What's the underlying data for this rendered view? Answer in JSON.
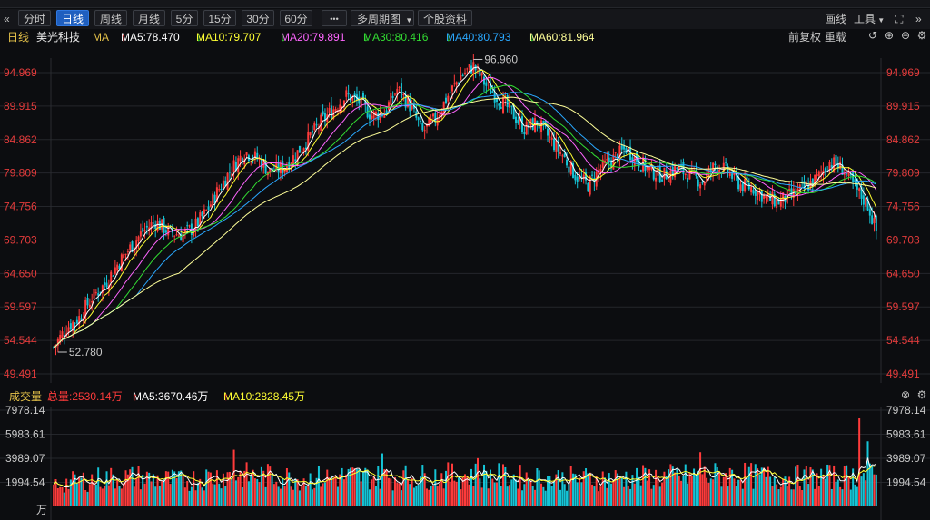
{
  "toolbar": {
    "back_glyph": "«",
    "periods": [
      "分时",
      "日线",
      "周线",
      "月线",
      "5分",
      "15分",
      "30分",
      "60分"
    ],
    "active_period": "日线",
    "more_label": "•••",
    "multi_period_label": "多周期图",
    "profile_label": "个股资料",
    "draw_label": "画线",
    "tools_label": "工具",
    "fullscreen_glyph": "⛶",
    "expand_glyph": "»"
  },
  "ma_bar": {
    "period": "日线",
    "stock": "美光科技",
    "ma": "MA",
    "ma5": "MA5:78.470",
    "ma10": "MA10:79.707",
    "ma20": "MA20:79.891",
    "ma30": "MA30:80.416",
    "ma40": "MA40:80.793",
    "ma60": "MA60:81.964",
    "adjust_label": "前复权",
    "reload_label": "重载"
  },
  "vol_bar": {
    "title": "成交量",
    "total": "总量:2530.14万",
    "ma5": "MA5:3670.46万",
    "ma10": "MA10:2828.45万"
  },
  "colors": {
    "up": "#ff3b3b",
    "down": "#15c4d6",
    "ma5": "#ffffff",
    "ma10": "#ffff33",
    "ma20": "#ff66ff",
    "ma30": "#33dd33",
    "ma40": "#2aa8ff",
    "ma60": "#ffff99"
  },
  "chart_data": {
    "type": "candlestick",
    "price_ticks": [
      "94.969",
      "89.915",
      "84.862",
      "79.809",
      "74.756",
      "69.703",
      "64.650",
      "59.597",
      "54.544",
      "49.491"
    ],
    "price_range": [
      49.491,
      94.969
    ],
    "high_annotation": "96.960",
    "low_annotation": "52.780",
    "volume_ticks": [
      "7978.14",
      "5983.61",
      "3989.07",
      "1994.54"
    ],
    "volume_unit": "万",
    "volume_range": [
      0,
      7978.14
    ],
    "series": [
      {
        "name": "MA5",
        "last": 78.47
      },
      {
        "name": "MA10",
        "last": 79.707
      },
      {
        "name": "MA20",
        "last": 79.891
      },
      {
        "name": "MA30",
        "last": 80.416
      },
      {
        "name": "MA40",
        "last": 80.793
      },
      {
        "name": "MA60",
        "last": 81.964
      }
    ],
    "close_trend": [
      [
        0,
        53.5
      ],
      [
        6,
        56.5
      ],
      [
        12,
        58.0
      ],
      [
        18,
        61.0
      ],
      [
        24,
        63.0
      ],
      [
        30,
        66.0
      ],
      [
        36,
        68.5
      ],
      [
        42,
        71.0
      ],
      [
        48,
        72.5
      ],
      [
        54,
        71.0
      ],
      [
        60,
        70.5
      ],
      [
        66,
        71.5
      ],
      [
        72,
        74.0
      ],
      [
        78,
        77.5
      ],
      [
        84,
        80.5
      ],
      [
        90,
        83.0
      ],
      [
        96,
        82.0
      ],
      [
        102,
        80.0
      ],
      [
        108,
        80.5
      ],
      [
        114,
        82.5
      ],
      [
        120,
        85.0
      ],
      [
        126,
        87.5
      ],
      [
        132,
        89.5
      ],
      [
        138,
        91.5
      ],
      [
        144,
        90.5
      ],
      [
        150,
        88.5
      ],
      [
        156,
        89.0
      ],
      [
        162,
        92.5
      ],
      [
        168,
        90.0
      ],
      [
        174,
        86.0
      ],
      [
        180,
        88.0
      ],
      [
        186,
        91.5
      ],
      [
        192,
        94.5
      ],
      [
        198,
        96.0
      ],
      [
        204,
        93.0
      ],
      [
        210,
        91.0
      ],
      [
        216,
        89.0
      ],
      [
        222,
        86.5
      ],
      [
        228,
        87.5
      ],
      [
        234,
        85.0
      ],
      [
        240,
        82.5
      ],
      [
        246,
        79.5
      ],
      [
        252,
        78.0
      ],
      [
        258,
        80.5
      ],
      [
        264,
        82.0
      ],
      [
        270,
        83.5
      ],
      [
        276,
        81.5
      ],
      [
        282,
        80.0
      ],
      [
        288,
        79.5
      ],
      [
        294,
        80.5
      ],
      [
        300,
        79.5
      ],
      [
        306,
        78.5
      ],
      [
        312,
        81.0
      ],
      [
        318,
        80.0
      ],
      [
        324,
        78.0
      ],
      [
        330,
        77.5
      ],
      [
        336,
        76.0
      ],
      [
        342,
        75.5
      ],
      [
        348,
        76.5
      ],
      [
        354,
        77.5
      ],
      [
        360,
        79.0
      ],
      [
        366,
        81.5
      ],
      [
        372,
        80.5
      ],
      [
        378,
        77.5
      ],
      [
        384,
        75.0
      ],
      [
        388,
        71.0
      ]
    ],
    "volume_profile": [
      [
        0,
        1800
      ],
      [
        20,
        2300
      ],
      [
        40,
        2400
      ],
      [
        60,
        2100
      ],
      [
        80,
        2600
      ],
      [
        100,
        2500
      ],
      [
        120,
        2300
      ],
      [
        140,
        2500
      ],
      [
        160,
        2400
      ],
      [
        180,
        2500
      ],
      [
        200,
        2600
      ],
      [
        220,
        2400
      ],
      [
        240,
        2300
      ],
      [
        260,
        2300
      ],
      [
        280,
        2400
      ],
      [
        300,
        2500
      ],
      [
        320,
        2600
      ],
      [
        340,
        2400
      ],
      [
        360,
        2400
      ],
      [
        380,
        2500
      ],
      [
        388,
        2530
      ]
    ],
    "volume_spikes": [
      [
        85,
        4700
      ],
      [
        155,
        4400
      ],
      [
        200,
        4000
      ],
      [
        305,
        4500
      ],
      [
        380,
        7300
      ],
      [
        384,
        5400
      ]
    ]
  }
}
